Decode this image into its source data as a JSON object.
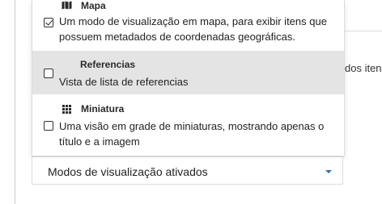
{
  "background": {
    "partial_text": "dos itens"
  },
  "options": [
    {
      "title": "Mapa",
      "icon": "map-icon",
      "checked": true,
      "description": "Um modo de visualização em mapa, para exibir itens que possuem metadados de coordenadas geográficas."
    },
    {
      "title": "Referencias",
      "icon": "",
      "checked": false,
      "description": "Vista de lista de referencias"
    },
    {
      "title": "Miniatura",
      "icon": "grid-icon",
      "checked": false,
      "description": "Uma visão em grade de miniaturas, mostrando apenas o título e a imagem"
    }
  ],
  "select": {
    "label": "Modos de visualização ativados"
  },
  "colors": {
    "hover_background": "#e4e4e4",
    "caret": "#2c6fb3"
  }
}
